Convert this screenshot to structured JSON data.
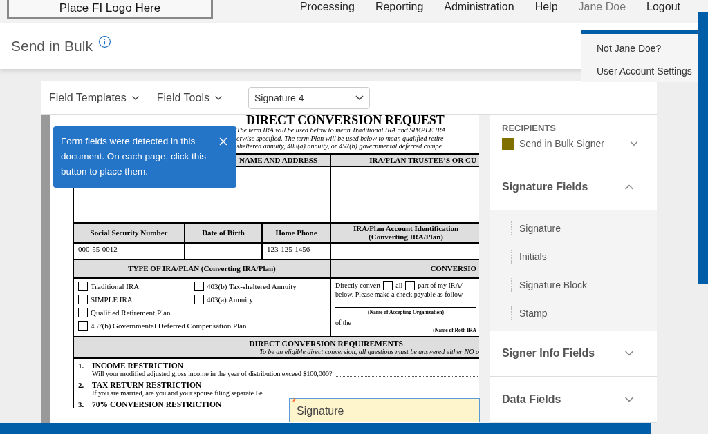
{
  "top_nav": {
    "logo": "Place FI Logo Here",
    "links": [
      {
        "label": "Processing",
        "selected": false
      },
      {
        "label": "Reporting",
        "selected": false
      },
      {
        "label": "Administration",
        "selected": false
      },
      {
        "label": "Help",
        "selected": false
      },
      {
        "label": "Jane Doe",
        "selected": true
      },
      {
        "label": "Logout",
        "selected": false
      }
    ]
  },
  "account_menu": {
    "items": [
      "Not Jane Doe?",
      "User Account Settings"
    ]
  },
  "page_header": {
    "title": "Send in Bulk"
  },
  "toolbar": {
    "menus": [
      "Field Templates",
      "Field Tools"
    ],
    "select": {
      "value": "Signature 4"
    }
  },
  "document": {
    "title": "DIRECT CONVERSION REQUEST",
    "intro_lines": [
      "The term IRA will be used below to mean Traditional IRA and SIMPLE IRA",
      "erwise specified. The term Plan will be used below to mean qualified retire",
      "sheltered annuity, 403(a) annuity, or 457(b) governmental deferred compe"
    ],
    "owner_header": "NAME AND ADDRESS",
    "trustee_header": "IRA/PLAN TRUSTEE’S OR CU",
    "info_columns": [
      {
        "header": "Social Security Number",
        "value": "000-55-0012"
      },
      {
        "header": "Date of Birth"
      },
      {
        "header": "Home Phone",
        "value": "123-125-1456"
      },
      {
        "header": "IRA/Plan Account Identification (Converting IRA/Plan)"
      }
    ],
    "type_header": "TYPE OF IRA/PLAN (Converting IRA/Plan)",
    "conversion_header": "CONVERSIO",
    "plan_types": [
      {
        "label": "Traditional IRA",
        "checked": false
      },
      {
        "label": "403(b) Tax-sheltered Annuity",
        "checked": false
      },
      {
        "label": "SIMPLE IRA",
        "checked": false
      },
      {
        "label": "403(a) Annuity",
        "checked": false
      },
      {
        "label": "Qualified Retirement Plan",
        "checked": false
      },
      {
        "label": "457(b) Governmental Deferred Compensation Plan",
        "checked": false
      }
    ],
    "conversion": {
      "convert_label": "Directly convert",
      "all_label": "all",
      "all_checked": false,
      "part_label": "part of my IRA/",
      "part_checked": false,
      "line2": "below. Please make a check payable as follow",
      "org_caption": "(Name of Accepting Organization)",
      "of_label": "of the",
      "roth_caption": "(Name of Roth IRA"
    },
    "requirements": {
      "title": "DIRECT CONVERSION REQUIREMENTS",
      "subtitle": "To be an eligible direct conversion, all questions must be answered either NO o",
      "items": [
        {
          "number": "1.",
          "title": "INCOME RESTRICTION",
          "text": "Will your modified adjusted gross income in the year of distribution exceed $100,000?"
        },
        {
          "number": "2.",
          "title": "TAX RETURN RESTRICTION",
          "text": "If you are married, are you and your spouse filing separate Fe"
        },
        {
          "number": "3.",
          "title": "70% CONVERSION RESTRICTION"
        }
      ]
    }
  },
  "tooltip": {
    "text": "Form fields were detected in this document. On each page, click this button to place them."
  },
  "signature_field": {
    "required_mark": "*",
    "label": "Signature"
  },
  "sidebar": {
    "recipients": {
      "heading": "RECIPIENTS",
      "recipient": {
        "name": "Send in Bulk Signer",
        "color": "#807000"
      }
    },
    "sections": [
      {
        "title": "Signature Fields",
        "expanded": true,
        "items": [
          "Signature",
          "Initials",
          "Signature Block",
          "Stamp"
        ]
      },
      {
        "title": "Signer Info Fields",
        "expanded": false
      },
      {
        "title": "Data Fields",
        "expanded": false
      }
    ]
  }
}
